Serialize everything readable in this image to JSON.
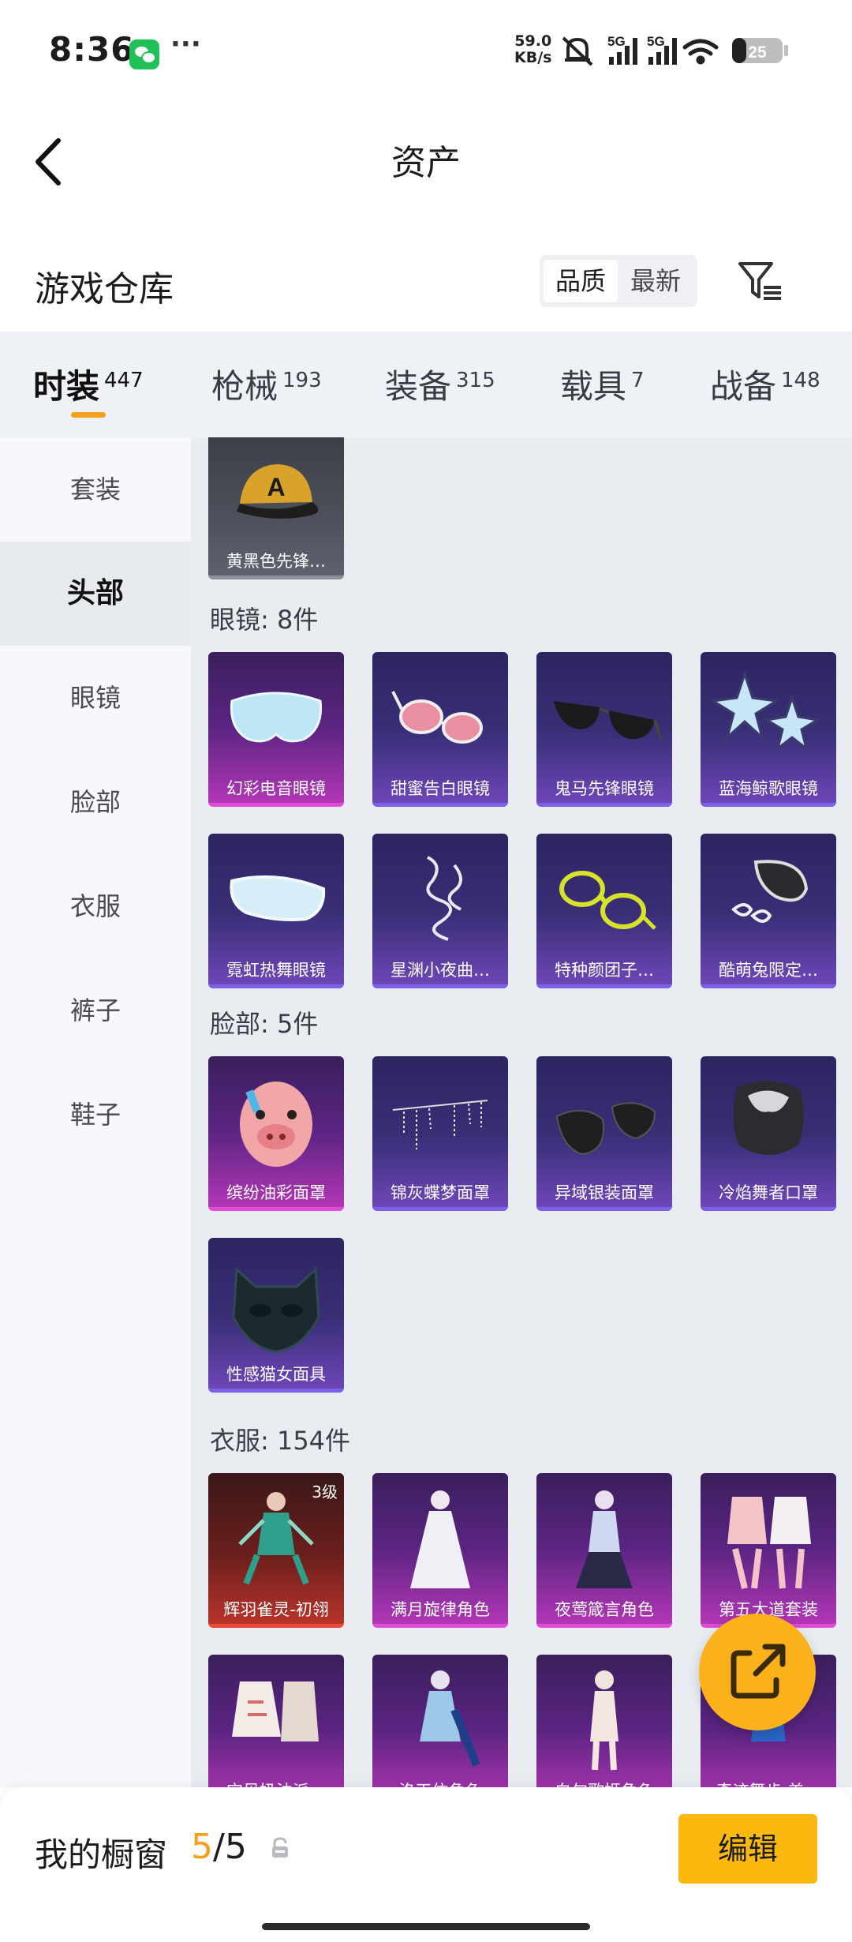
{
  "status_bar": {
    "time": "8:36",
    "more": "···",
    "net_speed_value": "59.0",
    "net_speed_unit": "KB/s",
    "signal_1": "5G",
    "signal_2": "5G",
    "battery": "25"
  },
  "header": {
    "title": "资产"
  },
  "warehouse": {
    "title": "游戏仓库",
    "sort_options": [
      "品质",
      "最新"
    ],
    "selected_sort": "品质"
  },
  "category_tabs": [
    {
      "label": "时装",
      "count": "447",
      "active": true
    },
    {
      "label": "枪械",
      "count": "193"
    },
    {
      "label": "装备",
      "count": "315"
    },
    {
      "label": "载具",
      "count": "7"
    },
    {
      "label": "战备",
      "count": "148"
    }
  ],
  "sidebar": {
    "items": [
      "套装",
      "头部",
      "眼镜",
      "脸部",
      "衣服",
      "裤子",
      "鞋子"
    ],
    "selected": "头部"
  },
  "sections": {
    "head_top_item": {
      "name": "黄黑色先锋…",
      "rarity": "gray",
      "icon": "cap-icon"
    },
    "glasses": {
      "title": "眼镜: 8件",
      "items": [
        {
          "name": "幻彩电音眼镜",
          "rarity": "magenta",
          "icon": "visor-icon"
        },
        {
          "name": "甜蜜告白眼镜",
          "rarity": "purple",
          "icon": "heart-glasses-icon"
        },
        {
          "name": "鬼马先锋眼镜",
          "rarity": "purple",
          "icon": "sunglasses-icon"
        },
        {
          "name": "蓝海鲸歌眼镜",
          "rarity": "purple",
          "icon": "star-glasses-icon"
        },
        {
          "name": "霓虹热舞眼镜",
          "rarity": "purple",
          "icon": "goggles-icon"
        },
        {
          "name": "星渊小夜曲…",
          "rarity": "purple",
          "icon": "ribbon-glasses-icon"
        },
        {
          "name": "特种颜团子…",
          "rarity": "purple",
          "icon": "round-glasses-icon"
        },
        {
          "name": "酷萌兔限定…",
          "rarity": "purple",
          "icon": "bunny-glasses-icon"
        }
      ]
    },
    "face": {
      "title": "脸部: 5件",
      "items": [
        {
          "name": "缤纷油彩面罩",
          "rarity": "magenta",
          "icon": "pig-mask-icon"
        },
        {
          "name": "锦灰蝶梦面罩",
          "rarity": "purple",
          "icon": "chain-mask-icon"
        },
        {
          "name": "异域银装面罩",
          "rarity": "purple",
          "icon": "half-mask-icon"
        },
        {
          "name": "冷焰舞者口罩",
          "rarity": "purple",
          "icon": "flame-mask-icon"
        },
        {
          "name": "性感猫女面具",
          "rarity": "purple",
          "icon": "cat-mask-icon"
        }
      ]
    },
    "clothes": {
      "title": "衣服: 154件",
      "items": [
        {
          "name": "辉羽雀灵-初翎",
          "rarity": "red",
          "level": "3级",
          "icon": "character-outfit-icon"
        },
        {
          "name": "满月旋律角色",
          "rarity": "magenta",
          "icon": "white-dress-icon"
        },
        {
          "name": "夜莺箴言角色",
          "rarity": "magenta",
          "icon": "gown-icon"
        },
        {
          "name": "第五大道套装",
          "rarity": "magenta",
          "icon": "suit-set-icon"
        },
        {
          "name": "宝贝奶油派…",
          "rarity": "magenta",
          "icon": "cream-outfit-icon"
        },
        {
          "name": "洛天依角色",
          "rarity": "magenta",
          "icon": "idol-outfit-icon"
        },
        {
          "name": "白勺歌姬角色",
          "rarity": "magenta",
          "icon": "singer-outfit-icon"
        },
        {
          "name": "奇迹舞步 美…",
          "rarity": "magenta",
          "icon": "dance-outfit-icon"
        }
      ]
    }
  },
  "bottom_bar": {
    "showcase_label": "我的橱窗",
    "showcase_used": "5",
    "showcase_total": "/5",
    "edit_label": "编辑"
  },
  "colors": {
    "accent": "#f4a01c",
    "edit_button": "#fbb80e",
    "purple_rarity": "#7a62e6",
    "magenta_rarity": "#e04bd8",
    "red_rarity": "#f04a34"
  }
}
